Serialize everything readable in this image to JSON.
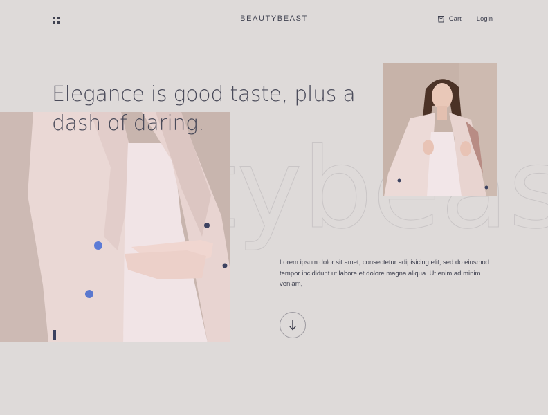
{
  "header": {
    "menu_icon": "grid-menu-icon",
    "brand": "BEAUTYBEAST",
    "cart_label": "Cart",
    "cart_icon": "shopping-bag-icon",
    "login_label": "Login"
  },
  "hero": {
    "headline": "Elegance is good taste, plus a dash of daring.",
    "background_word": "beautybeast",
    "description": "Lorem ipsum dolor sit amet, consectetur adipisicing elit, sed do eiusmod tempor incididunt ut labore et dolore magna aliqua. Ut enim ad minim veniam,",
    "scroll_icon": "arrow-down-icon"
  },
  "colors": {
    "background": "#dedad9",
    "text": "#3f4150",
    "jacket": "#e9d6d3"
  }
}
